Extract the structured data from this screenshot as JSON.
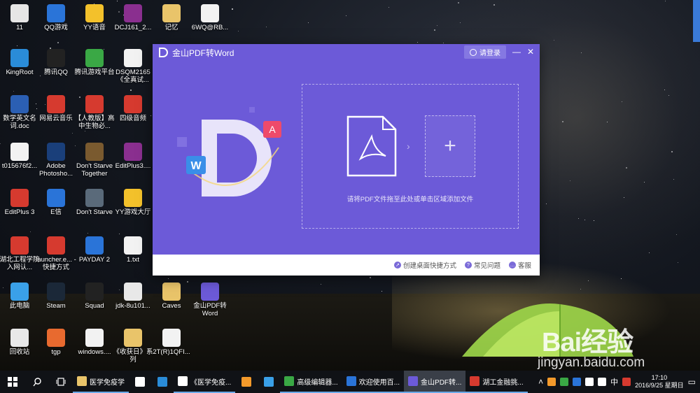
{
  "desktop": {
    "icons": [
      {
        "label": "11",
        "icon": "drive-icon",
        "color": "#e6e6e6"
      },
      {
        "label": "QQ游戏",
        "icon": "qq-game-icon",
        "color": "#2a74d8"
      },
      {
        "label": "YY语音",
        "icon": "yy-icon",
        "color": "#f3c12b"
      },
      {
        "label": "DCJ161_2...",
        "icon": "rar-icon",
        "color": "#8a2f8f"
      },
      {
        "label": "记忆",
        "icon": "folder-icon",
        "color": "#e9c46a"
      },
      {
        "label": "6WQ@RB...",
        "icon": "file-icon",
        "color": "#f2f2f2"
      },
      {
        "label": "KingRoot",
        "icon": "kingroot-icon",
        "color": "#2a8cd8"
      },
      {
        "label": "腾讯QQ",
        "icon": "qq-icon",
        "color": "#222222"
      },
      {
        "label": "腾讯游戏平台",
        "icon": "tencent-game-icon",
        "color": "#3aa845"
      },
      {
        "label": "DSQM2165 《全真试...",
        "icon": "doc-icon",
        "color": "#f2f2f2"
      },
      {
        "label": "数学英文名词.doc",
        "icon": "word-doc-icon",
        "color": "#2b5fb3"
      },
      {
        "label": "网易云音乐",
        "icon": "netease-music-icon",
        "color": "#d63a2f"
      },
      {
        "label": "【人教版】高中生物必...",
        "icon": "pdf-file-icon",
        "color": "#d63a2f"
      },
      {
        "label": "四级音频",
        "icon": "audio-icon",
        "color": "#d63a2f"
      },
      {
        "label": "t015676f2...",
        "icon": "image-file-icon",
        "color": "#f2f2f2"
      },
      {
        "label": "Adobe Photosho...",
        "icon": "photoshop-icon",
        "color": "#1a3f7a"
      },
      {
        "label": "Don't Starve Together",
        "icon": "dont-starve-icon",
        "color": "#7a5a2f"
      },
      {
        "label": "EditPlus3....",
        "icon": "rar-icon",
        "color": "#8a2f8f"
      },
      {
        "label": "EditPlus 3",
        "icon": "editplus-icon",
        "color": "#d63a2f"
      },
      {
        "label": "E信",
        "icon": "exin-icon",
        "color": "#2a74d8"
      },
      {
        "label": "Don't Starve",
        "icon": "dont-starve-icon",
        "color": "#5a6a7a"
      },
      {
        "label": "YY游戏大厅",
        "icon": "yy-game-icon",
        "color": "#f3c12b"
      },
      {
        "label": "湖北工程学院入网认...",
        "icon": "network-icon",
        "color": "#d63a2f"
      },
      {
        "label": "launcher.e... - 快捷方式",
        "icon": "launcher-icon",
        "color": "#d63a2f"
      },
      {
        "label": "PAYDAY 2",
        "icon": "payday-icon",
        "color": "#2a74d8"
      },
      {
        "label": "1.txt",
        "icon": "txt-icon",
        "color": "#f2f2f2"
      },
      {
        "label": "此电脑",
        "icon": "computer-icon",
        "color": "#3aa0e8"
      },
      {
        "label": "Steam",
        "icon": "steam-icon",
        "color": "#1b2838"
      },
      {
        "label": "Squad",
        "icon": "squad-icon",
        "color": "#222222"
      },
      {
        "label": "jdk-8u101...",
        "icon": "jdk-icon",
        "color": "#e8e8e8"
      },
      {
        "label": "Caves",
        "icon": "folder-icon",
        "color": "#e9c46a"
      },
      {
        "label": "金山PDF转Word",
        "icon": "kingsoft-pdf-icon",
        "color": "#6c5ad8"
      },
      {
        "label": "回收站",
        "icon": "recycle-bin-icon",
        "color": "#e8e8e8"
      },
      {
        "label": "tgp",
        "icon": "tgp-icon",
        "color": "#e86a2f"
      },
      {
        "label": "windows....",
        "icon": "windows-file-icon",
        "color": "#f2f2f2"
      },
      {
        "label": "《收获日》系列",
        "icon": "folder-icon",
        "color": "#e9c46a"
      },
      {
        "label": "2T(R)1QFI...",
        "icon": "file-icon",
        "color": "#f2f2f2"
      }
    ]
  },
  "window": {
    "title": "金山PDF转Word",
    "login_label": "请登录",
    "minimize_glyph": "—",
    "close_glyph": "✕",
    "drop_hint": "请将PDF文件拖至此处或单击区域添加文件",
    "add_glyph": "+",
    "arrow_glyph": "›",
    "accent": "#6c5ad8",
    "footer": {
      "shortcut_label": "创建桌面快捷方式",
      "faq_label": "常见问题",
      "service_label": "客服"
    }
  },
  "taskbar": {
    "tasks": [
      {
        "label": "医学免疫学",
        "icon": "folder-icon",
        "color": "#e9c46a"
      },
      {
        "label": "",
        "icon": "store-icon",
        "color": "#ffffff"
      },
      {
        "label": "",
        "icon": "edge-icon",
        "color": "#2a8cd8"
      },
      {
        "label": "《医学免疫...",
        "icon": "doc-icon",
        "color": "#ffffff"
      },
      {
        "label": "",
        "icon": "browser-icon",
        "color": "#f39a2b"
      },
      {
        "label": "",
        "icon": "app-icon",
        "color": "#3aa0e8"
      },
      {
        "label": "高级编辑器...",
        "icon": "editor-icon",
        "color": "#3aa845"
      },
      {
        "label": "欢迎使用百...",
        "icon": "baidu-icon",
        "color": "#2a74d8"
      },
      {
        "label": "金山PDF转...",
        "icon": "kingsoft-pdf-icon",
        "color": "#6c5ad8"
      },
      {
        "label": "湖工金融挑...",
        "icon": "app-icon",
        "color": "#d63a2f"
      }
    ],
    "ime": "中",
    "time": "17:10",
    "date": "2016/9/25 星期日"
  },
  "watermark": {
    "brand": "Bai经验",
    "url": "jingyan.baidu.com"
  }
}
